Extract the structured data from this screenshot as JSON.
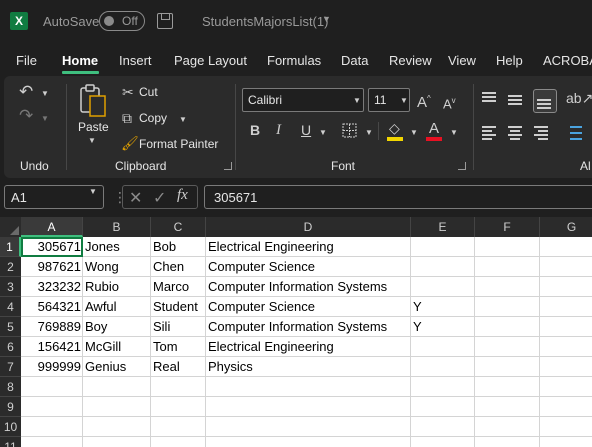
{
  "titlebar": {
    "app_icon": "X",
    "autosave_label": "AutoSave",
    "autosave_state": "Off",
    "filename": "StudentsMajorsList(1)"
  },
  "menu": [
    "File",
    "Home",
    "Insert",
    "Page Layout",
    "Formulas",
    "Data",
    "Review",
    "View",
    "Help",
    "ACROBA"
  ],
  "ribbon": {
    "undo_group": "Undo",
    "clipboard_group": "Clipboard",
    "font_group": "Font",
    "paste_label": "Paste",
    "cut_label": "Cut",
    "copy_label": "Copy",
    "format_painter_label": "Format Painter",
    "font_name": "Calibri",
    "font_size": "11",
    "grow_font": "A",
    "shrink_font": "A",
    "bold": "B",
    "italic": "I",
    "underline": "U",
    "font_color_letter": "A",
    "alignment_group_partial": "Al",
    "highlight_color": "#f2d600",
    "font_color": "#e81123"
  },
  "formula_bar": {
    "name_box": "A1",
    "fx": "fx",
    "value": "305671"
  },
  "columns": [
    "A",
    "B",
    "C",
    "D",
    "E",
    "F",
    "G"
  ],
  "rows": [
    "1",
    "2",
    "3",
    "4",
    "5",
    "6",
    "7",
    "8",
    "9",
    "10",
    "11"
  ],
  "selected_cell": "A1",
  "sheet": [
    [
      "305671",
      "Jones",
      "Bob",
      "Electrical Engineering",
      ""
    ],
    [
      "987621",
      "Wong",
      "Chen",
      "Computer Science",
      ""
    ],
    [
      "323232",
      "Rubio",
      "Marco",
      "Computer Information Systems",
      ""
    ],
    [
      "564321",
      "Awful",
      "Student",
      "Computer Science",
      "Y"
    ],
    [
      "769889",
      "Boy",
      "Sili",
      "Computer Information Systems",
      "Y"
    ],
    [
      "156421",
      "McGill",
      "Tom",
      "Electrical Engineering",
      ""
    ],
    [
      "999999",
      "Genius",
      "Real",
      "Physics",
      ""
    ]
  ]
}
